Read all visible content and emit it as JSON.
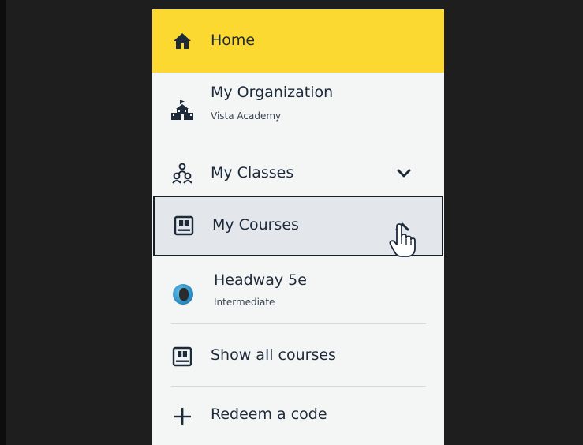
{
  "menu": {
    "home": {
      "label": "Home",
      "icon": "home-icon"
    },
    "organization": {
      "label": "My Organization",
      "sublabel": "Vista Academy",
      "icon": "school-building-icon"
    },
    "classes": {
      "label": "My Classes",
      "icon": "people-group-icon",
      "expanded": false
    },
    "courses": {
      "label": "My Courses",
      "icon": "book-icon",
      "expanded": true
    },
    "course_item": {
      "label": "Headway 5e",
      "sublabel": "Intermediate",
      "icon": "course-avatar"
    },
    "show_all": {
      "label": "Show all courses",
      "icon": "book-icon"
    },
    "redeem": {
      "label": "Redeem a code",
      "icon": "plus-icon"
    }
  },
  "colors": {
    "highlight": "#fcd930",
    "panel_bg": "#f4f5f5",
    "selected_bg": "#e3e7eb",
    "text": "#1c2a3a",
    "backdrop": "#1e1e1e"
  }
}
